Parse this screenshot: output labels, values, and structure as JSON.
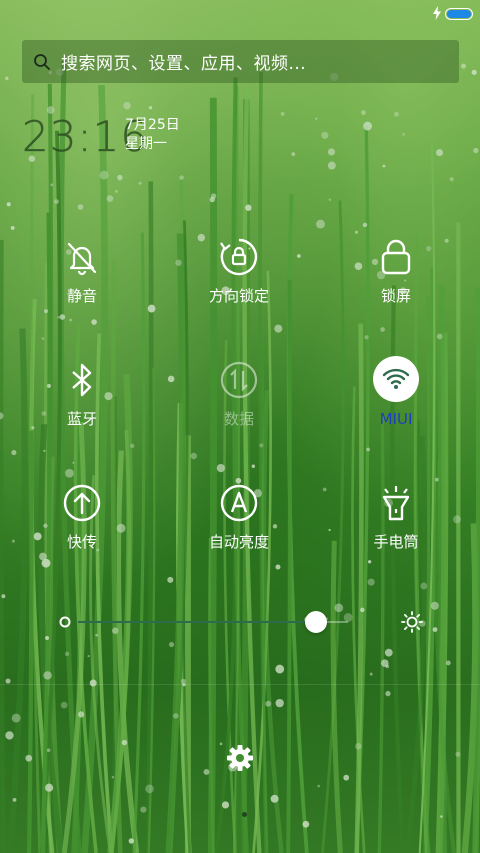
{
  "search": {
    "placeholder": "搜索网页、设置、应用、视频..."
  },
  "clock": {
    "time": "23:16",
    "date": "7月25日",
    "weekday": "星期一"
  },
  "toggles": [
    {
      "label": "静音",
      "icon": "bell-off-icon"
    },
    {
      "label": "方向锁定",
      "icon": "rotation-lock-icon"
    },
    {
      "label": "锁屏",
      "icon": "lock-icon"
    },
    {
      "label": "蓝牙",
      "icon": "bluetooth-icon"
    },
    {
      "label": "数据",
      "icon": "mobile-data-icon",
      "state": "disabled"
    },
    {
      "label": "MIUI",
      "icon": "wifi-icon",
      "state": "active"
    },
    {
      "label": "快传",
      "icon": "upload-circle-icon"
    },
    {
      "label": "自动亮度",
      "icon": "auto-brightness-icon"
    },
    {
      "label": "手电筒",
      "icon": "flashlight-icon"
    }
  ],
  "brightness": {
    "level": 0.88
  },
  "colors": {
    "battery": "#1e88e5",
    "active_label": "#1f3fbd",
    "slider_fill": "#2e6b4e"
  }
}
